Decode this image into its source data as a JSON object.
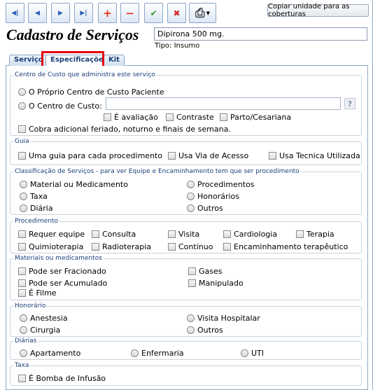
{
  "toolbar": {
    "buttons": [
      {
        "name": "first-record-button",
        "glyph": "◀|",
        "color": "#2a5fb5"
      },
      {
        "name": "previous-record-button",
        "glyph": "◀",
        "color": "#2a5fb5"
      },
      {
        "name": "next-record-button",
        "glyph": "▶",
        "color": "#2a5fb5"
      },
      {
        "name": "last-record-button",
        "glyph": "▶|",
        "color": "#2a5fb5"
      },
      {
        "name": "add-button",
        "glyph": "+",
        "color": "#e2361a"
      },
      {
        "name": "remove-button",
        "glyph": "−",
        "color": "#e2361a"
      },
      {
        "name": "confirm-button",
        "glyph": "✔",
        "color": "#2e9a2e"
      },
      {
        "name": "cancel-button",
        "glyph": "✖",
        "color": "#d22a2a"
      }
    ],
    "print_glyph": "⎙",
    "copy_label": "Copiar unidade para as coberturas"
  },
  "header": {
    "title": "Cadastro de Serviços",
    "item_name": "Dipirona 500 mg.",
    "tipo": "Tipo: Insumo"
  },
  "tabs": [
    "Serviço",
    "Especificações",
    "Kit"
  ],
  "centro_custo": {
    "legend": "Centro de Custo que administra este serviço",
    "opt_proprio": "O Próprio Centro de Custo Paciente",
    "opt_centro": "O Centro de Custo:",
    "help": "?",
    "chk_avaliacao": "É avaliação",
    "chk_contraste": "Contraste",
    "chk_parto": "Parto/Cesariana",
    "chk_cobra": "Cobra adicional feriado, noturno e finais de semana."
  },
  "guia": {
    "legend": "Guia",
    "items": [
      "Uma guia para cada procedimento",
      "Usa Via de Acesso",
      "Usa Tecnica Utilizada"
    ]
  },
  "classificacao": {
    "legend": "Classificação de Serviços - para ver Equipe e Encaminhamento tem que ser procedimento",
    "items": [
      "Material ou Medicamento",
      "Procedimentos",
      "Taxa",
      "Honorários",
      "Diária",
      "Outros"
    ]
  },
  "procedimento": {
    "legend": "Procedimento",
    "items": [
      "Requer equipe",
      "Consulta",
      "Visita",
      "Cardiologia",
      "Terapia",
      "Quimioterapia",
      "Radioterapia",
      "Contínuo",
      "Encaminhamento terapêutico"
    ]
  },
  "materiais": {
    "legend": "Materiais ou medicamentos",
    "items": [
      "Pode ser Fracionado",
      "Gases",
      "Pode ser Acumulado",
      "Manipulado",
      "É Filme"
    ]
  },
  "honorario": {
    "legend": "Honorário",
    "items": [
      "Anestesia",
      "Visita Hospitalar",
      "Cirurgia",
      "Outros"
    ]
  },
  "diarias": {
    "legend": "Diárias",
    "items": [
      "Apartamento",
      "Enfermaria",
      "UTI"
    ]
  },
  "taxa": {
    "legend": "Taxa",
    "items": [
      "É Bomba de Infusão"
    ]
  },
  "colors": {
    "highlight": "#e3000f",
    "accent": "#1c3e7a",
    "border": "#8fa6c4"
  }
}
